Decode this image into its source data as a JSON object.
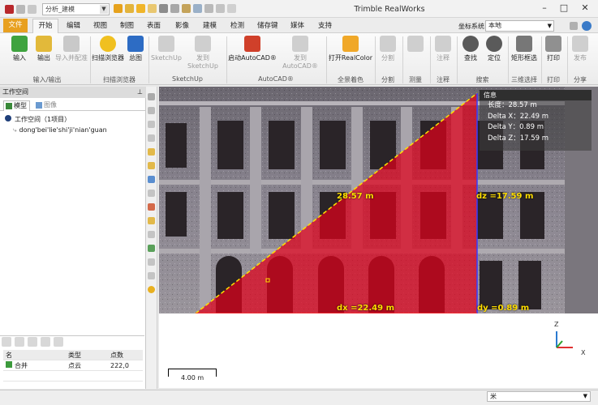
{
  "window": {
    "title": "Trimble RealWorks",
    "quick_select": "分析_建模",
    "coord_label": "坐标系统",
    "coord_value": "本地"
  },
  "tabs": [
    "文件",
    "开始",
    "编辑",
    "视图",
    "制图",
    "表面",
    "影像",
    "建模",
    "检测",
    "储存键",
    "媒体",
    "支持"
  ],
  "ribbon": {
    "groups": [
      {
        "label": "输入/输出",
        "buttons": [
          "输入",
          "输出",
          "导入并配准"
        ]
      },
      {
        "label": "扫描浏览器",
        "buttons": [
          "扫描浏览器",
          "总图"
        ]
      },
      {
        "label": "SketchUp",
        "buttons": [
          "SketchUp",
          "发到SketchUp"
        ]
      },
      {
        "label": "AutoCAD®",
        "buttons": [
          "启动AutoCAD®",
          "发到AutoCAD®"
        ]
      },
      {
        "label": "全景着色",
        "buttons": [
          "打开RealColor"
        ]
      },
      {
        "label": "分割",
        "buttons": [
          "分割"
        ]
      },
      {
        "label": "测量",
        "buttons": []
      },
      {
        "label": "注释",
        "buttons": [
          "注释"
        ]
      },
      {
        "label": "搜索",
        "buttons": [
          "查找",
          "定位"
        ]
      },
      {
        "label": "三维选择",
        "buttons": [
          "矩形框选"
        ]
      },
      {
        "label": "打印",
        "buttons": [
          "打印"
        ]
      },
      {
        "label": "分享",
        "buttons": [
          "发布"
        ]
      }
    ]
  },
  "workspace": {
    "title": "工作空间",
    "tabs": [
      "模型",
      "图像"
    ],
    "root": "工作空间（1项目）",
    "project": "dong'bei'lie'shi'ji'nian'guan"
  },
  "properties": {
    "headers": [
      "名",
      "类型",
      "点数"
    ],
    "rows": [
      [
        "合并",
        "点云",
        "222,0"
      ],
      [
        "",
        "",
        ""
      ]
    ]
  },
  "info": {
    "title": "信息",
    "lines": [
      "长度：28.57 m",
      "Delta X：22.49 m",
      "Delta Y：0.89 m",
      "Delta Z：17.59 m"
    ]
  },
  "measure": {
    "length": "28.57 m",
    "dz": "dz =17.59 m",
    "dx": "dx =22.49 m",
    "dy": "dy =0.89 m"
  },
  "scale": "4.00 m",
  "axes": {
    "z": "Z",
    "x": "X"
  },
  "status": "米"
}
